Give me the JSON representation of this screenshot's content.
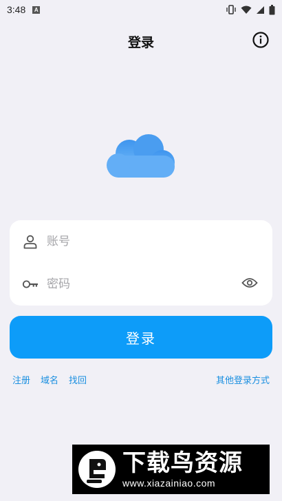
{
  "status_bar": {
    "time": "3:48",
    "indicator": "A",
    "icons": [
      "vibrate-icon",
      "wifi-icon",
      "signal-icon",
      "battery-icon"
    ]
  },
  "header": {
    "title": "登录",
    "info_icon": "info-icon"
  },
  "logo": {
    "icon": "cloud-icon",
    "color": "#5aa9f5"
  },
  "form": {
    "account": {
      "icon": "user-icon",
      "placeholder": "账号",
      "value": ""
    },
    "password": {
      "icon": "key-icon",
      "placeholder": "密码",
      "value": "",
      "toggle_icon": "eye-icon"
    }
  },
  "login_button": {
    "label": "登录",
    "color": "#0d9cf9"
  },
  "links": {
    "register": "注册",
    "domain": "域名",
    "recover": "找回",
    "other_login": "其他登录方式"
  },
  "watermark": {
    "text": "下载鸟资源",
    "url": "www.xiazainiao.com"
  },
  "colors": {
    "background": "#f1f0f6",
    "link": "#1a8fe0",
    "card": "#ffffff"
  }
}
